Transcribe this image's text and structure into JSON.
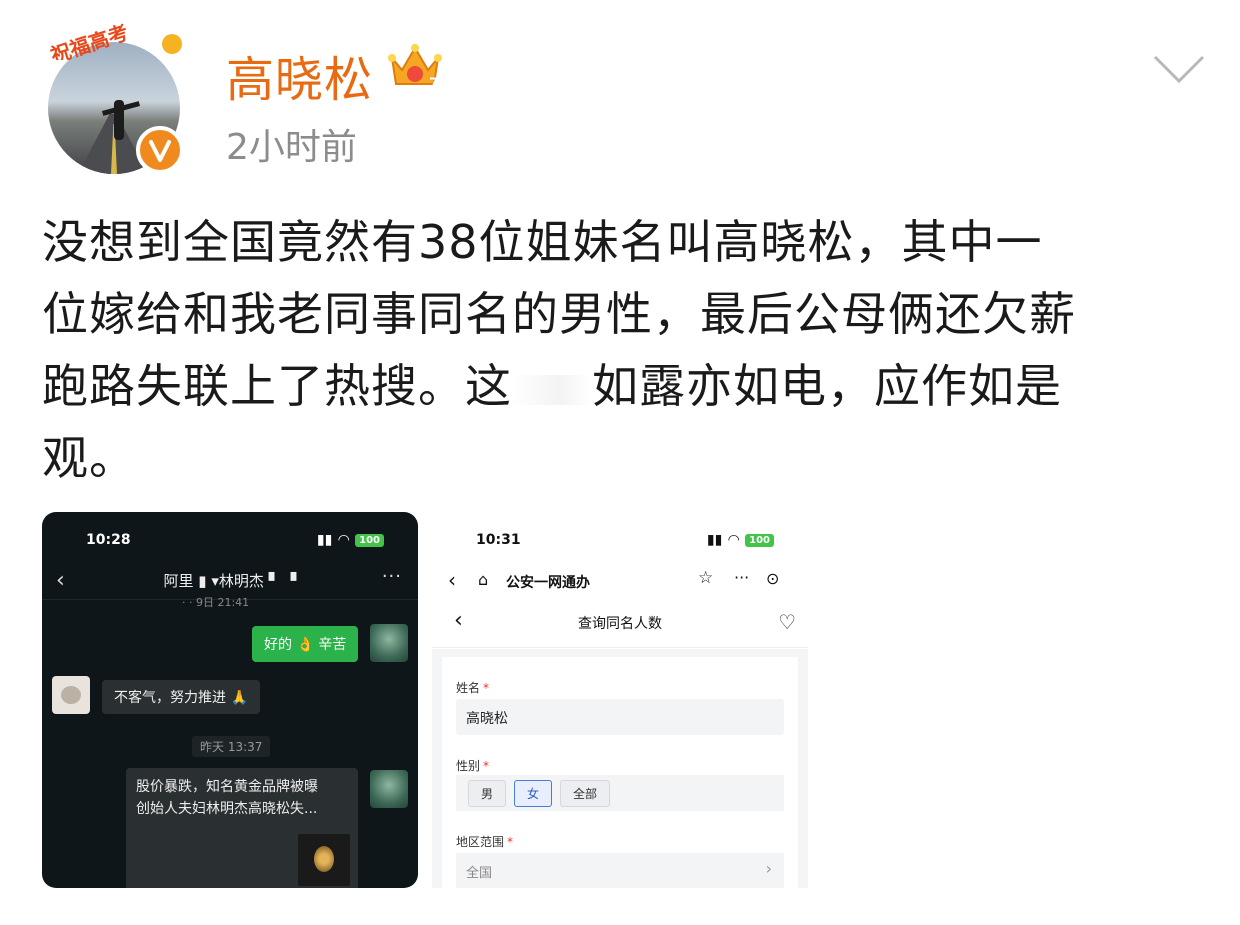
{
  "header": {
    "user_name": "高晓松",
    "time": "2小时前",
    "avatar_ribbon": "祝福高考"
  },
  "post": {
    "line1": "没想到全国竟然有38位姐妹名叫高晓松，其中一",
    "line2": "位嫁给和我老同事同名的男性，最后公母俩还欠薪",
    "line3a": "跑路失联上了热搜。这",
    "line3b": "如露亦如电，应作如是",
    "line4": "观。"
  },
  "shot1": {
    "status_time": "10:28",
    "battery": "100",
    "chat_title": "阿里 ▮ ▾林明杰 ▘ ▝",
    "cut_stamp": "· · 9日 21:41",
    "bubble_mine": "好的 👌 辛苦",
    "bubble_other": "不客气，努力推进 🙏",
    "stamp": "昨天 13:37",
    "link_line1": "股价暴跌，知名黄金品牌被曝",
    "link_line2": "创始人夫妇林明杰高晓松失..."
  },
  "shot2": {
    "status_time": "10:31",
    "battery": "100",
    "mini_app_name": "公安一网通办",
    "page_title": "查询同名人数",
    "name_label": "姓名",
    "name_value": "高晓松",
    "gender_label": "性别",
    "gender_options": [
      "男",
      "女",
      "全部"
    ],
    "gender_selected": "女",
    "region_label": "地区范围",
    "region_value": "全国",
    "required_mark": "*"
  }
}
